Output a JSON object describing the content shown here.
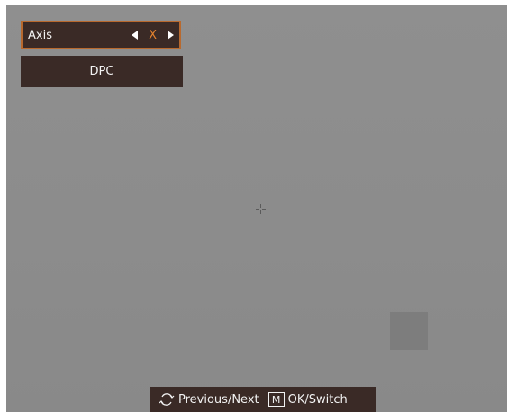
{
  "menu": {
    "axis_label": "Axis",
    "axis_value": "X",
    "dpc_label": "DPC"
  },
  "hint": {
    "rotate_icon": "rotate-icon",
    "prev_next_label": "Previous/Next",
    "m_key_label": "M",
    "ok_switch_label": "OK/Switch"
  },
  "colors": {
    "menu_background": "#3a2a26",
    "selection_border": "#b8692e",
    "selected_value": "#e3822e",
    "viewport_gray": "#8c8c8c"
  }
}
